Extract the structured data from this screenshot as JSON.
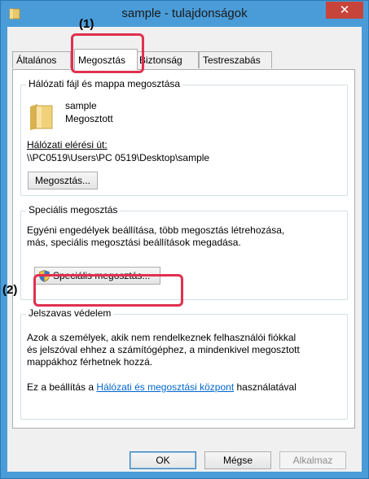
{
  "window": {
    "title": "sample - tulajdonságok",
    "close_glyph": "✕",
    "title_color": "#4a9cd8"
  },
  "callouts": {
    "one": "(1)",
    "two": "(2)",
    "color": "#e0304e"
  },
  "tabs": [
    {
      "label": "Általános",
      "active": false
    },
    {
      "label": "Megosztás",
      "active": true
    },
    {
      "label": "Biztonság",
      "active": false
    },
    {
      "label": "Testreszabás",
      "active": false
    }
  ],
  "network_sharing": {
    "group_title": "Hálózati fájl és mappa megosztása",
    "folder_name": "sample",
    "folder_state": "Megosztott",
    "path_label": "Hálózati elérési út:",
    "path_value": "\\\\PC0519\\Users\\PC 0519\\Desktop\\sample",
    "share_button": "Megosztás..."
  },
  "advanced_sharing": {
    "group_title": "Speciális megosztás",
    "description": [
      "Egyéni engedélyek beállítása, több megosztás létrehozása,",
      "más, speciális megosztási beállítások megadása."
    ],
    "button": "Speciális megosztás..."
  },
  "password_protection": {
    "group_title": "Jelszavas védelem",
    "description": [
      "Azok a személyek, akik nem rendelkeznek felhasználói fiókkal",
      "és jelszóval ehhez a számítógéphez, a mindenkivel megosztott",
      "mappákhoz férhetnek hozzá."
    ],
    "setting_prefix": "Ez a beállítás a",
    "setting_link": "Hálózati és megosztási központ",
    "setting_suffix": "használatával"
  },
  "footer": {
    "ok": "OK",
    "cancel": "Mégse",
    "apply": "Alkalmaz"
  },
  "icons": {
    "folder": "folder-icon",
    "shield": "uac-shield-icon"
  }
}
